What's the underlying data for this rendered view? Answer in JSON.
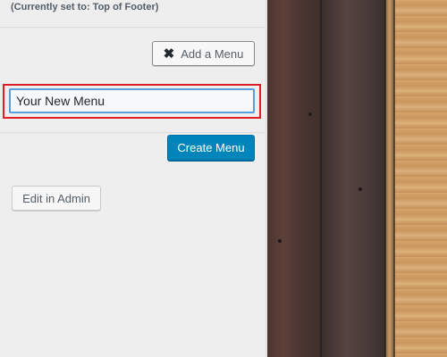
{
  "panel": {
    "location_note": "(Currently set to: Top of Footer)",
    "add_menu_button": {
      "icon": "close-x-icon",
      "label": "Add a Menu"
    },
    "menu_name_input": {
      "value": "Your New Menu"
    },
    "create_menu_button": {
      "label": "Create Menu"
    },
    "edit_in_admin_button": {
      "label": "Edit in Admin"
    }
  },
  "colors": {
    "panel_background": "#eeeeee",
    "primary_button": "#0085ba",
    "highlight_border": "#e01e25",
    "input_focus_border": "#5b9dd9"
  }
}
